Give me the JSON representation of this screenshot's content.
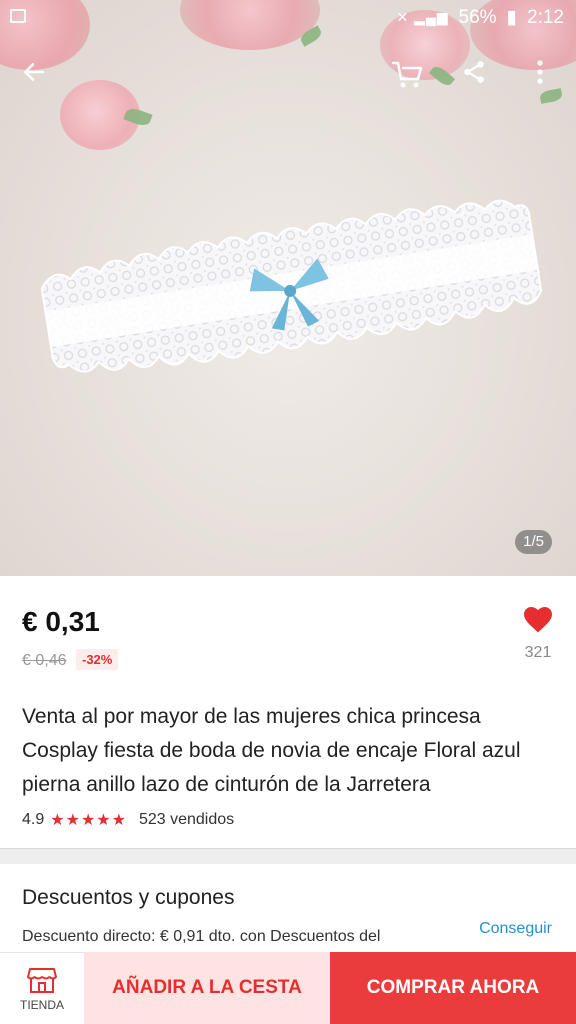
{
  "status_bar": {
    "battery": "56%",
    "time": "2:12"
  },
  "gallery": {
    "counter": "1/5"
  },
  "product": {
    "price": "€ 0,31",
    "old_price": "€ 0,46",
    "discount": "-32%",
    "likes": "321",
    "title": "Venta al por mayor de las mujeres chica princesa Cosplay fiesta de boda de novia de encaje Floral azul pierna anillo lazo de cinturón de la Jarretera",
    "rating": "4.9",
    "stars": "★★★★★",
    "sold": "523 vendidos"
  },
  "coupons": {
    "title": "Descuentos y cupones",
    "description": "Descuento directo: € 0,91 dto. con Descuentos del",
    "action": "Conseguir"
  },
  "bottom_bar": {
    "store_label": "TIENDA",
    "add_to_cart": "AÑADIR A LA CESTA",
    "buy_now": "COMPRAR AHORA"
  },
  "icons": {
    "back": "arrow-left-icon",
    "cart": "cart-icon",
    "share": "share-icon",
    "more": "more-vertical-icon",
    "heart": "heart-icon",
    "store": "store-icon"
  },
  "colors": {
    "accent": "#e62e2e",
    "link": "#2a8fc8",
    "add_cart_bg": "#fde3e1",
    "buy_bg": "#ea3c3c"
  }
}
